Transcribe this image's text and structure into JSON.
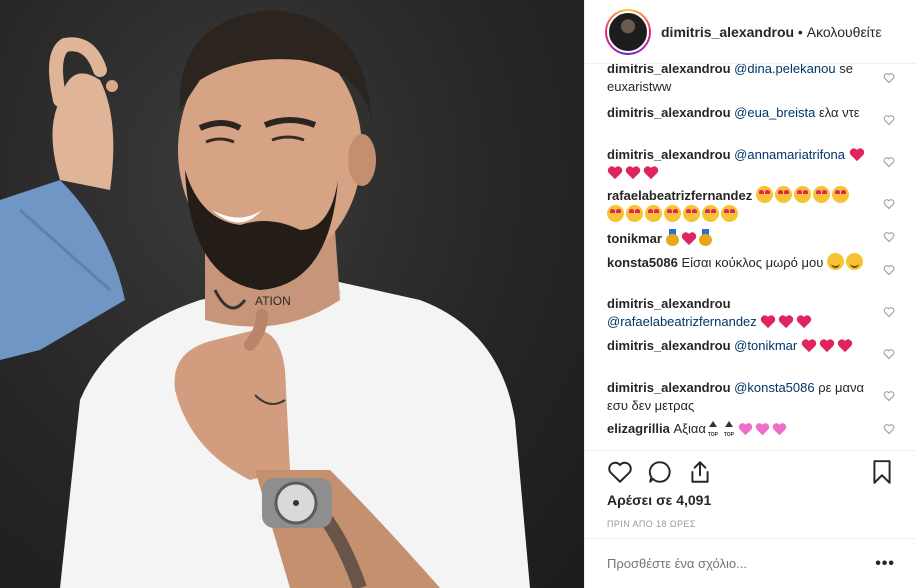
{
  "header": {
    "username": "dimitris_alexandrou",
    "separator": " • ",
    "follow_label": "Ακολουθείτε"
  },
  "comments": [
    {
      "user": "dimitris_alexandrou",
      "mention": "@dina.pelekanou",
      "text": "se euxaristww"
    },
    {
      "user": "dimitris_alexandrou",
      "mention": "@eua_breista",
      "text": "ελα ντε"
    },
    {
      "user": "dimitris_alexandrou",
      "mention": "@annamariatrifona",
      "text": ""
    },
    {
      "user": "rafaelabeatrizfernandez",
      "mention": "",
      "text": ""
    },
    {
      "user": "tonikmar",
      "mention": "",
      "text": ""
    },
    {
      "user": "konsta5086",
      "mention": "",
      "text": "Είσαι κούκλος μωρό μου"
    },
    {
      "user": "dimitris_alexandrou",
      "mention": "@rafaelabeatrizfernandez",
      "text": ""
    },
    {
      "user": "dimitris_alexandrou",
      "mention": "@tonikmar",
      "text": ""
    },
    {
      "user": "dimitris_alexandrou",
      "mention": "@konsta5086",
      "text": "ρε μανα εσυ δεν μετρας"
    },
    {
      "user": "elizagrillia",
      "mention": "",
      "text": "Αξιαα"
    }
  ],
  "emoji_names": {
    "heart": "red-heart-emoji",
    "love": "heart-eyes-emoji",
    "smile": "smiley-emoji",
    "medal": "medal-emoji",
    "top": "top-arrow-emoji",
    "pheart": "pink-heart-emoji"
  },
  "top_emoji_label": "TOP",
  "likes_label": "Αρέσει σε 4,091",
  "timestamp": "ΠΡΙΝ ΑΠΟ 18 ΩΡΕΣ",
  "add_comment_placeholder": "Προσθέστε ένα σχόλιο...",
  "more_label": "•••",
  "colors": {
    "mention": "#003569",
    "heart_red": "#e0245e",
    "pink_heart": "#f06ec8",
    "secondary_text": "#999999"
  }
}
